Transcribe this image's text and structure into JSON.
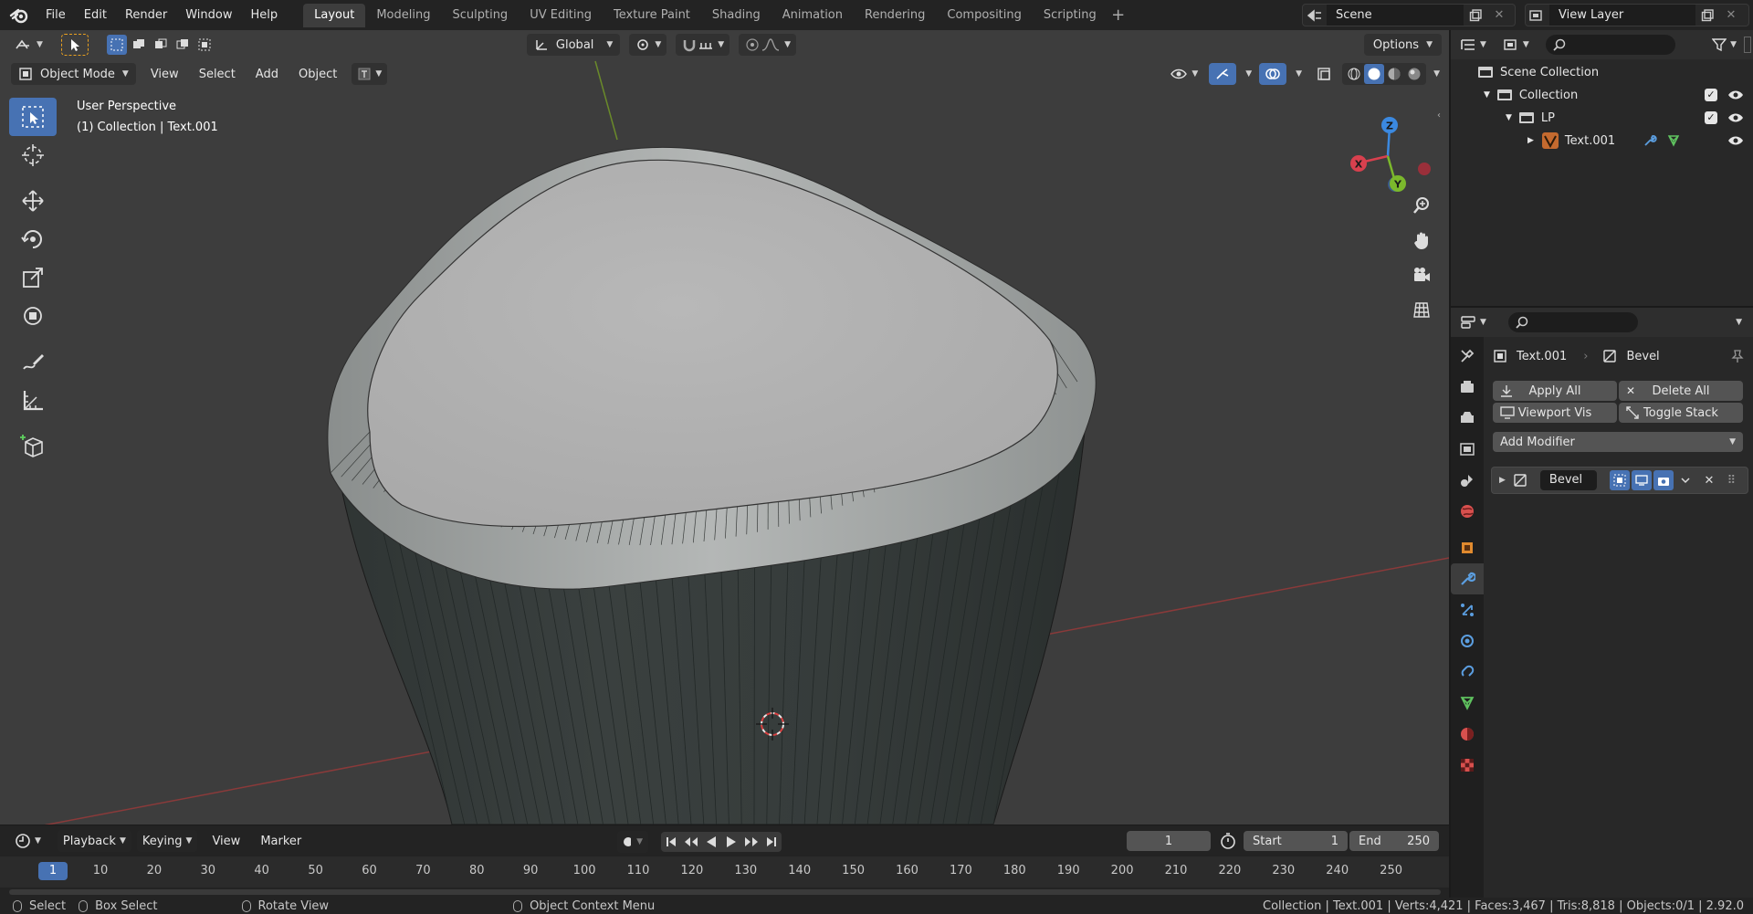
{
  "topbar": {
    "menus": [
      "File",
      "Edit",
      "Render",
      "Window",
      "Help"
    ],
    "workspaces": [
      "Layout",
      "Modeling",
      "Sculpting",
      "UV Editing",
      "Texture Paint",
      "Shading",
      "Animation",
      "Rendering",
      "Compositing",
      "Scripting"
    ],
    "active_workspace": "Layout",
    "scene": "Scene",
    "view_layer": "View Layer"
  },
  "viewport": {
    "transform_orientation": "Global",
    "options_label": "Options",
    "mode": "Object Mode",
    "menus": [
      "View",
      "Select",
      "Add",
      "Object"
    ],
    "overlay_line1": "User Perspective",
    "overlay_line2": "(1) Collection | Text.001",
    "gizmo_axes": {
      "x": "X",
      "y": "Y",
      "z": "Z"
    },
    "colors": {
      "x_axis": "#d8404e",
      "y_axis": "#7bb82c",
      "z_axis": "#3b89e0",
      "accent": "#4772b3",
      "background": "#3d3d3d"
    }
  },
  "timeline": {
    "menus": [
      "Playback",
      "Keying",
      "View",
      "Marker"
    ],
    "current_frame": "1",
    "start_label": "Start",
    "start": "1",
    "end_label": "End",
    "end": "250",
    "ticks": [
      "10",
      "20",
      "30",
      "40",
      "50",
      "60",
      "70",
      "80",
      "90",
      "100",
      "110",
      "120",
      "130",
      "140",
      "150",
      "160",
      "170",
      "180",
      "190",
      "200",
      "210",
      "220",
      "230",
      "240",
      "250"
    ]
  },
  "statusbar": {
    "select": "Select",
    "box_select": "Box Select",
    "rotate_view": "Rotate View",
    "context_menu": "Object Context Menu",
    "stats": "Collection | Text.001 | Verts:4,421 | Faces:3,467 | Tris:8,818 | Objects:0/1 | 2.92.0"
  },
  "outliner": {
    "scene_collection": "Scene Collection",
    "collection": "Collection",
    "lp": "LP",
    "object": "Text.001"
  },
  "properties": {
    "object_name": "Text.001",
    "modifier_context": "Bevel",
    "apply_all": "Apply All",
    "delete_all": "Delete All",
    "viewport_vis": "Viewport Vis",
    "toggle_stack": "Toggle Stack",
    "add_modifier": "Add Modifier",
    "modifier_name": "Bevel"
  }
}
